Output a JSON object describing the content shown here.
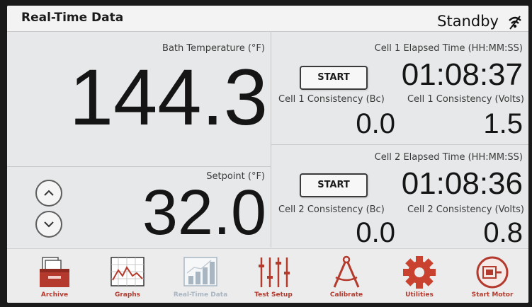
{
  "header": {
    "title": "Real-Time Data",
    "status": "Standby",
    "signal_icon": "signal-icon"
  },
  "bath": {
    "label": "Bath Temperature (°F)",
    "value": "144.3"
  },
  "setpoint": {
    "label": "Setpoint (°F)",
    "value": "32.0"
  },
  "cell1": {
    "elapsed_label": "Cell 1 Elapsed Time (HH:MM:SS)",
    "elapsed_value": "01:08:37",
    "start_label": "START",
    "bc_label": "Cell 1 Consistency (Bc)",
    "bc_value": "0.0",
    "volts_label": "Cell 1 Consistency (Volts)",
    "volts_value": "1.5"
  },
  "cell2": {
    "elapsed_label": "Cell 2 Elapsed Time (HH:MM:SS)",
    "elapsed_value": "01:08:36",
    "start_label": "START",
    "bc_label": "Cell 2 Consistency (Bc)",
    "bc_value": "0.0",
    "volts_label": "Cell 2 Consistency (Volts)",
    "volts_value": "0.8"
  },
  "toolbar": {
    "items": [
      {
        "label": "Archive",
        "icon": "archive-icon"
      },
      {
        "label": "Graphs",
        "icon": "graphs-icon"
      },
      {
        "label": "Real-Time Data",
        "icon": "real-time-data-icon"
      },
      {
        "label": "Test Setup",
        "icon": "test-setup-icon"
      },
      {
        "label": "Calibrate",
        "icon": "calibrate-icon"
      },
      {
        "label": "Utilities",
        "icon": "utilities-icon"
      },
      {
        "label": "Start Motor",
        "icon": "start-motor-icon"
      }
    ]
  },
  "colors": {
    "accent": "#b43a2e",
    "disabled": "#a9b6c2",
    "background": "#eaebec"
  }
}
